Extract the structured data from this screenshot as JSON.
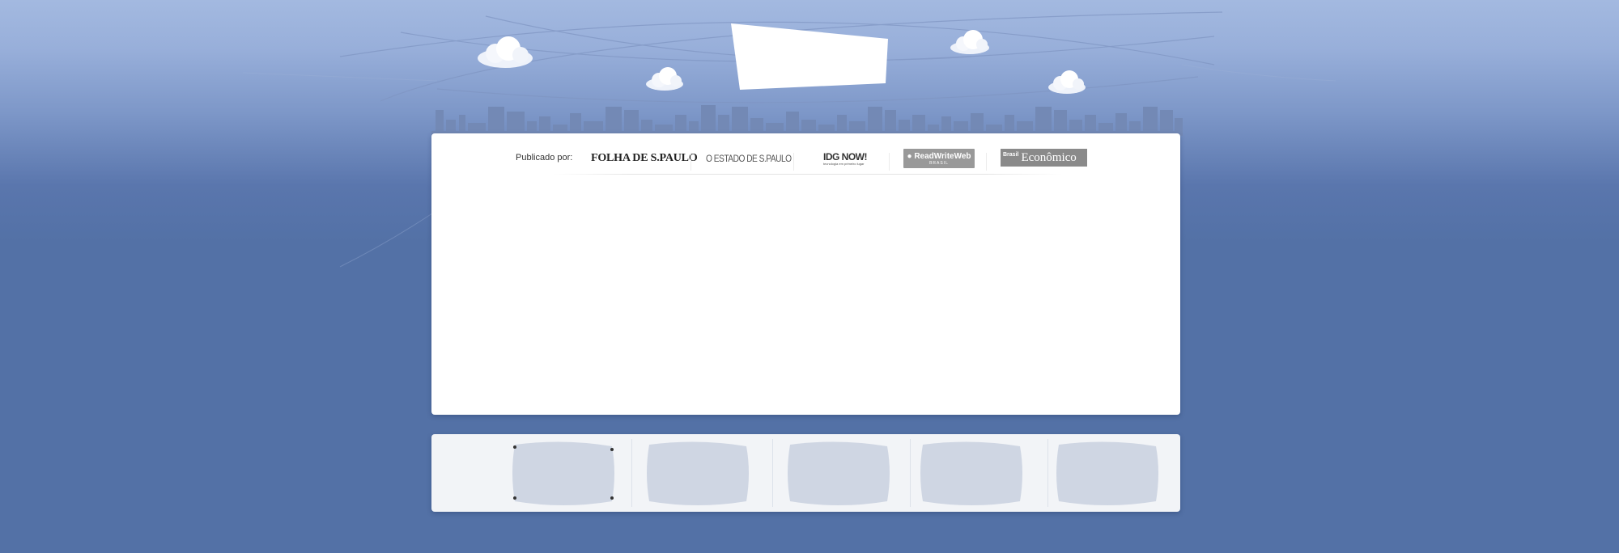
{
  "header": {
    "logo_area": ""
  },
  "published_by": {
    "label": "Publicado por:",
    "outlets": [
      {
        "name": "FOLHA DE S.PAULO"
      },
      {
        "name": "O ESTADO DE S.PAULO"
      },
      {
        "name": "IDG NOW!",
        "tagline": "tecnologia em primeiro lugar"
      },
      {
        "name": "ReadWriteWeb",
        "sub": "BRASIL"
      },
      {
        "name": "Econômico",
        "prefix": "Brasil"
      }
    ]
  },
  "thumbnails": {
    "count": 5
  },
  "colors": {
    "background": "#5371a6",
    "sky_top": "#a3b9e0",
    "skyline": "#7389b5",
    "panel": "#ffffff",
    "thumb_placeholder": "#cfd6e3"
  }
}
